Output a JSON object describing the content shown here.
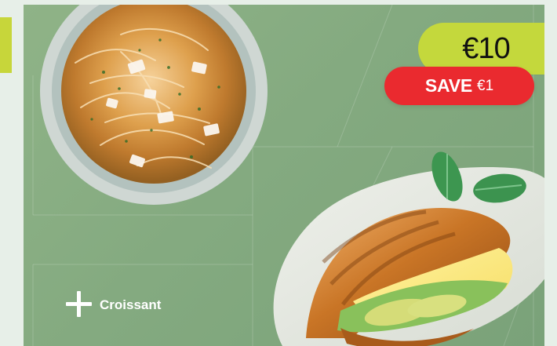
{
  "offer": {
    "price": "€10",
    "save_label": "SAVE",
    "save_amount": "€1",
    "addon_label": "Croissant"
  },
  "icons": {
    "plus": "plus-icon"
  },
  "colors": {
    "background": "#e7efe8",
    "card_green": "#84aa80",
    "price_pill": "#c4d83c",
    "save_pill": "#ea2a2f",
    "text_light": "#ffffff",
    "text_dark": "#111111"
  }
}
